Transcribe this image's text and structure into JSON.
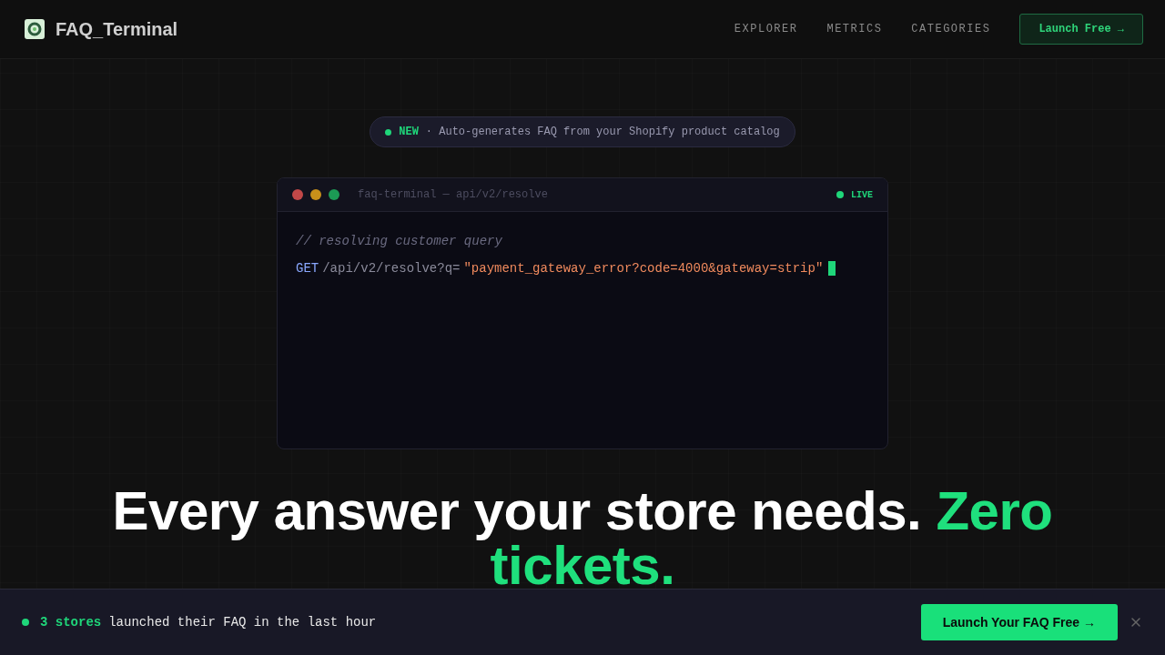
{
  "nav": {
    "brand": "FAQ_Terminal",
    "links": [
      "EXPLORER",
      "METRICS",
      "CATEGORIES"
    ],
    "cta": "Launch Free →"
  },
  "badge": {
    "tag": "NEW",
    "text": "· Auto-generates FAQ from your Shopify product catalog"
  },
  "terminal": {
    "title": "faq-terminal — api/v2/resolve",
    "status": "LIVE",
    "comment": "// resolving customer query",
    "method": "GET",
    "path": "/api/v2/resolve?q=",
    "query": "\"payment_gateway_error?code=4000&gateway=strip\""
  },
  "headline": [
    {
      "text": "Every answer your store needs.",
      "accent": false
    },
    {
      "text": "Zero tickets.",
      "accent": true
    }
  ],
  "banner": {
    "count": "3 stores",
    "text": "launched their FAQ in the last hour",
    "button": "Launch Your FAQ Free →"
  }
}
